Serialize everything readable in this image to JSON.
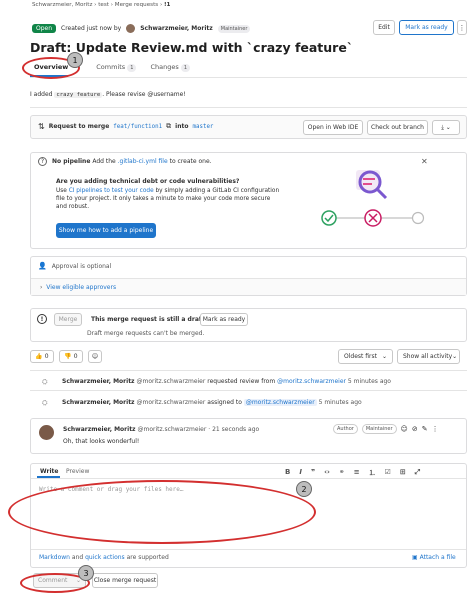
{
  "breadcrumb": {
    "items": [
      "Schwarzmeier, Moritz",
      "test",
      "Merge requests",
      "!1"
    ],
    "sep": "›"
  },
  "header": {
    "status": "Open",
    "created_text": "Created just now by",
    "author": "Schwarzmeier, Moritz",
    "author_role": "Maintainer",
    "edit_label": "Edit",
    "mark_ready_label": "Mark as ready",
    "title": "Draft: Update Review.md with `crazy feature`"
  },
  "tabs": [
    {
      "label": "Overview",
      "count": "0"
    },
    {
      "label": "Commits",
      "count": "1"
    },
    {
      "label": "Changes",
      "count": "1"
    }
  ],
  "description": {
    "pre": "I added",
    "code": "crazy feature",
    "post": ". Please revise @username!"
  },
  "merge_request": {
    "request_label": "Request to merge",
    "source_branch": "feat/function1",
    "into_label": "into",
    "target_branch": "master",
    "web_ide_label": "Open in Web IDE",
    "checkout_label": "Check out branch"
  },
  "pipeline": {
    "no_pipeline": "No pipeline",
    "add_prefix": "Add the",
    "ci_file": ".gitlab-ci.yml file",
    "add_suffix": "to create one.",
    "heading": "Are you adding technical debt or code vulnerabilities?",
    "body_use": "Use",
    "body_link": "CI pipelines to test your code",
    "body_line1": "by simply adding a GitLab CI configuration",
    "body_line2": "file to your project. It only takes a minute to make your code more secure",
    "body_line3": "and robust.",
    "button_label": "Show me how to add a pipeline"
  },
  "approval": {
    "optional_text": "Approval is optional",
    "eligible_text": "View eligible approvers"
  },
  "merge_box": {
    "merge_label": "Merge",
    "draft_text": "This merge request is still a draft.",
    "mark_ready_label": "Mark as ready",
    "cant_merge_text": "Draft merge requests can't be merged."
  },
  "reactions": {
    "thumbs_up": "0",
    "thumbs_down": "0",
    "sort_label": "Oldest first",
    "filter_label": "Show all activity"
  },
  "activity": [
    {
      "author": "Schwarzmeier, Moritz",
      "handle": "@moritz.schwarzmeier",
      "action": "requested review from",
      "target": "@moritz.schwarzmeier",
      "time": "5 minutes ago"
    },
    {
      "author": "Schwarzmeier, Moritz",
      "handle": "@moritz.schwarzmeier",
      "action": "assigned to",
      "target": "@moritz.schwarzmeier",
      "time": "5 minutes ago"
    }
  ],
  "comment": {
    "author": "Schwarzmeier, Moritz",
    "handle": "@moritz.schwarzmeier",
    "time": "· 21 seconds ago",
    "badge_author": "Author",
    "badge_maintainer": "Maintainer",
    "body": "Oh, that looks wonderful!"
  },
  "editor": {
    "tab_write": "Write",
    "tab_preview": "Preview",
    "placeholder": "Write a comment or drag your files here…",
    "markdown_label": "Markdown",
    "and_label": "and",
    "quick_actions_label": "quick actions",
    "supported_label": "are supported",
    "attach_label": "Attach a file",
    "comment_label": "Comment",
    "close_label": "Close merge request"
  },
  "annotations": [
    "1",
    "2",
    "3"
  ],
  "colors": {
    "annotation_red": "#d32f2f",
    "brand_blue": "#1f75cb",
    "open_green": "#108548"
  }
}
